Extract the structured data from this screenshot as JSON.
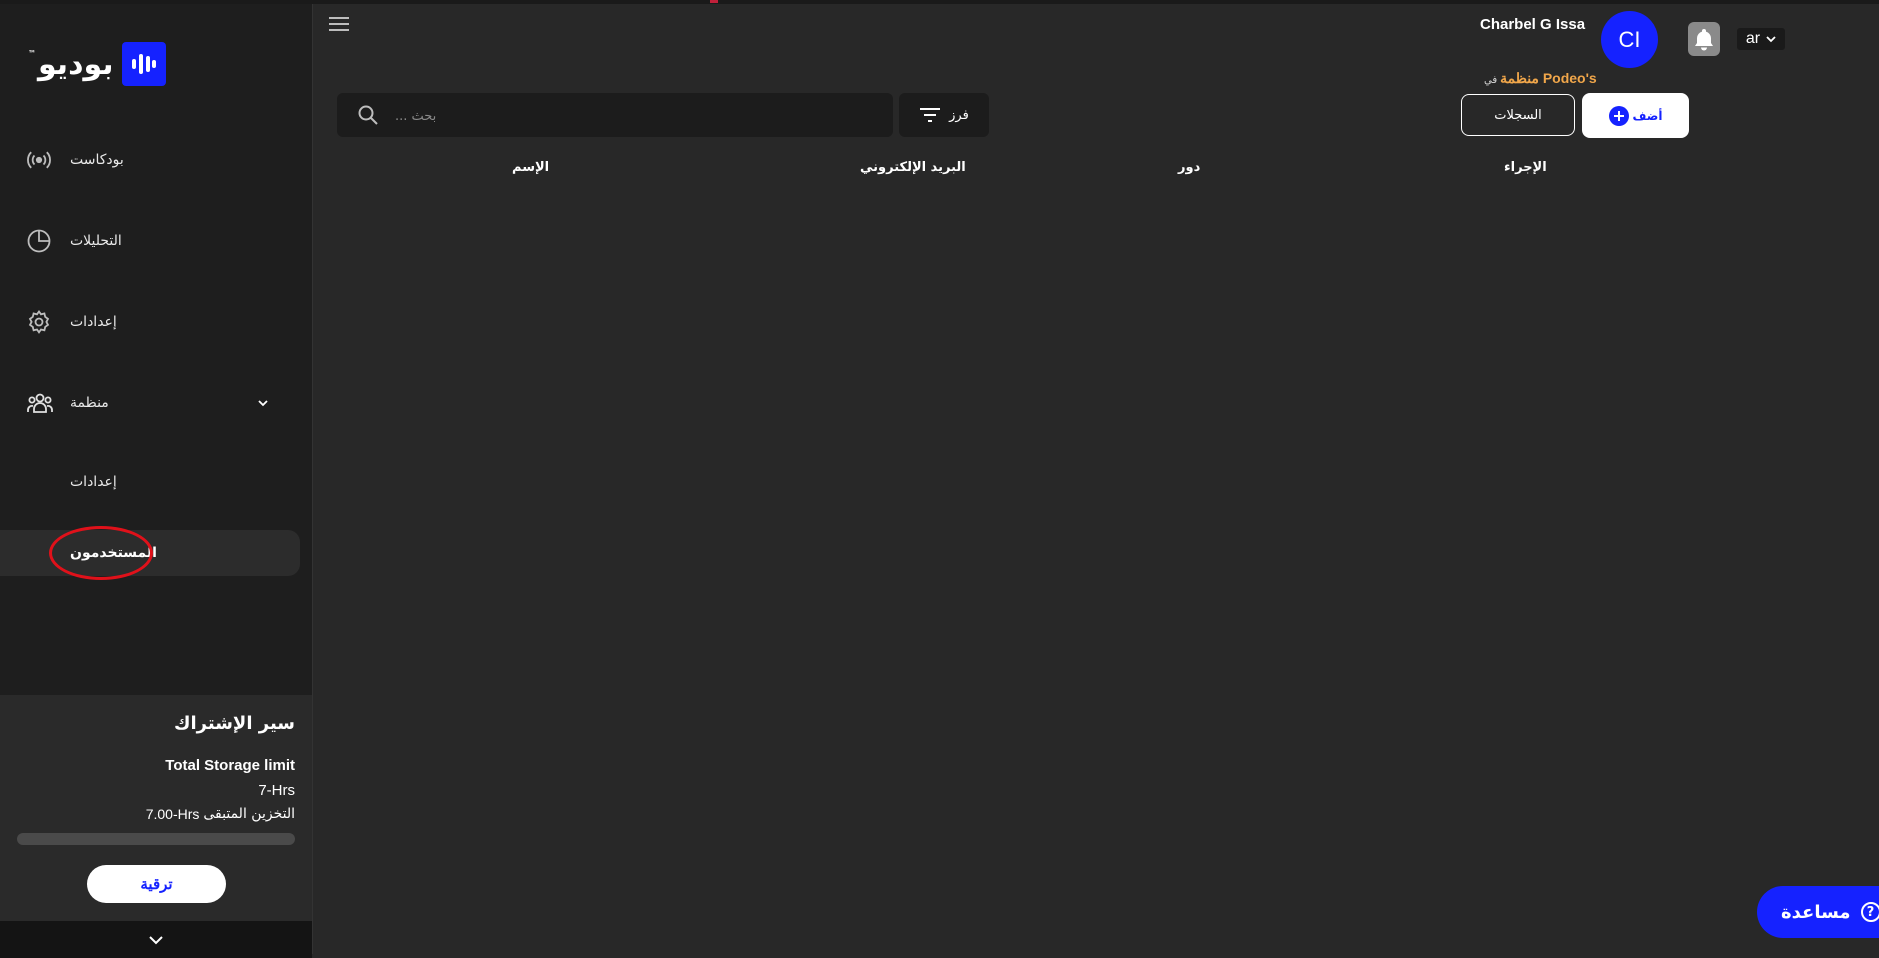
{
  "sidebar": {
    "logo_text": "بوديو",
    "logo_tm": "™",
    "nav": [
      {
        "label": "بودكاست",
        "icon": "broadcast-icon"
      },
      {
        "label": "التحليلات",
        "icon": "pie-chart-icon"
      },
      {
        "label": "إعدادات",
        "icon": "gear-icon"
      },
      {
        "label": "منظمة",
        "icon": "team-icon"
      }
    ],
    "org_sub": [
      {
        "label": "إعدادات"
      },
      {
        "label": "المستخدمون",
        "active": true
      }
    ],
    "subscription": {
      "title": "سير الإشتراك",
      "storage_title": "Total Storage limit",
      "storage_hrs": "7-Hrs",
      "remaining_value": "7.00-Hrs",
      "remaining_label": "التخزين المتبقى",
      "progress_fraction": 0.0,
      "upgrade_label": "ترقية"
    }
  },
  "header": {
    "user_name": "Charbel G Issa",
    "avatar_initials": "CI",
    "org_prefix": "في",
    "org_name": "منظمة Podeo's",
    "language": "ar"
  },
  "toolbar": {
    "search_placeholder": "بحث ...",
    "sort_label": "فرز",
    "logs_label": "السجلات",
    "add_label": "أضف"
  },
  "table": {
    "columns": [
      "الإسم",
      "البريد الإلكتروني",
      "دور",
      "الإجراء"
    ]
  },
  "help": {
    "label": "مساعدة"
  },
  "colors": {
    "accent": "#1522ff",
    "org_highlight": "#f0a64a",
    "background": "#282828",
    "sidebar": "#1e1e1e"
  }
}
